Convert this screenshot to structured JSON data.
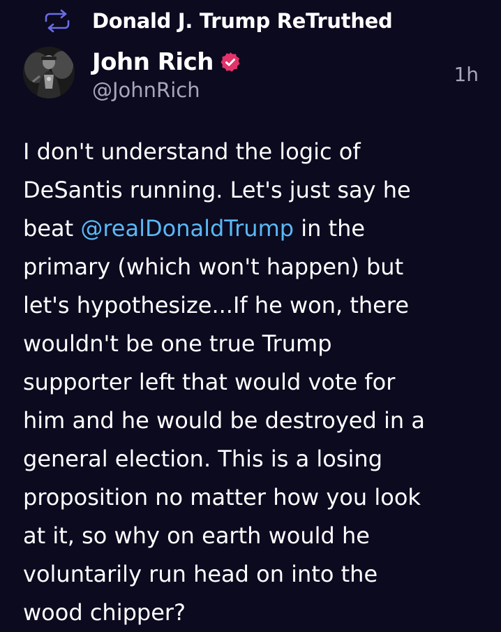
{
  "retruth": {
    "icon": "retruth-arrows-icon",
    "label": "Donald J. Trump ReTruthed"
  },
  "author": {
    "display_name": "John Rich",
    "handle": "@JohnRich",
    "verified_icon": "verified-badge-icon",
    "avatar": "avatar-photo"
  },
  "post": {
    "timestamp": "1h",
    "text_before_mention": "I don't understand the logic of\nDeSantis running. Let's just say he\nbeat ",
    "mention": "@realDonaldTrump",
    "text_after_mention": " in the\nprimary (which won't happen) but\nlet's hypothesize...If he won, there\nwouldn't be one true Trump\nsupporter left that would vote for\nhim and he would be destroyed in a\ngeneral election. This is a losing\nproposition no matter how you look\nat it, so why on earth would he\nvoluntarily run head on into the\nwood chipper?"
  },
  "colors": {
    "background": "#0b0a1f",
    "mention": "#5bb8f5",
    "secondary_text": "#a8a6b8",
    "verified_badge": "#e2336a"
  }
}
